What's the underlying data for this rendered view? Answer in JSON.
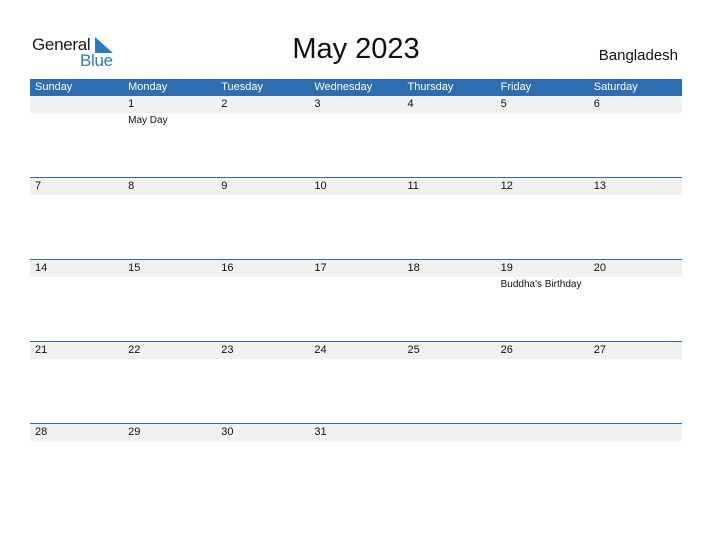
{
  "logo": {
    "line1": "General",
    "line2": "Blue"
  },
  "title": "May 2023",
  "country": "Bangladesh",
  "colors": {
    "accent": "#2e6db0",
    "strip": "#f1f1f1",
    "logo_blue": "#2a7bc4"
  },
  "weekdays": [
    "Sunday",
    "Monday",
    "Tuesday",
    "Wednesday",
    "Thursday",
    "Friday",
    "Saturday"
  ],
  "weeks": [
    {
      "days": [
        "",
        "1",
        "2",
        "3",
        "4",
        "5",
        "6"
      ],
      "events": [
        "",
        "May Day",
        "",
        "",
        "",
        "",
        ""
      ]
    },
    {
      "days": [
        "7",
        "8",
        "9",
        "10",
        "11",
        "12",
        "13"
      ],
      "events": [
        "",
        "",
        "",
        "",
        "",
        "",
        ""
      ]
    },
    {
      "days": [
        "14",
        "15",
        "16",
        "17",
        "18",
        "19",
        "20"
      ],
      "events": [
        "",
        "",
        "",
        "",
        "",
        "Buddha's Birthday",
        ""
      ]
    },
    {
      "days": [
        "21",
        "22",
        "23",
        "24",
        "25",
        "26",
        "27"
      ],
      "events": [
        "",
        "",
        "",
        "",
        "",
        "",
        ""
      ]
    },
    {
      "days": [
        "28",
        "29",
        "30",
        "31",
        "",
        "",
        ""
      ],
      "events": [
        "",
        "",
        "",
        "",
        "",
        "",
        ""
      ]
    }
  ]
}
